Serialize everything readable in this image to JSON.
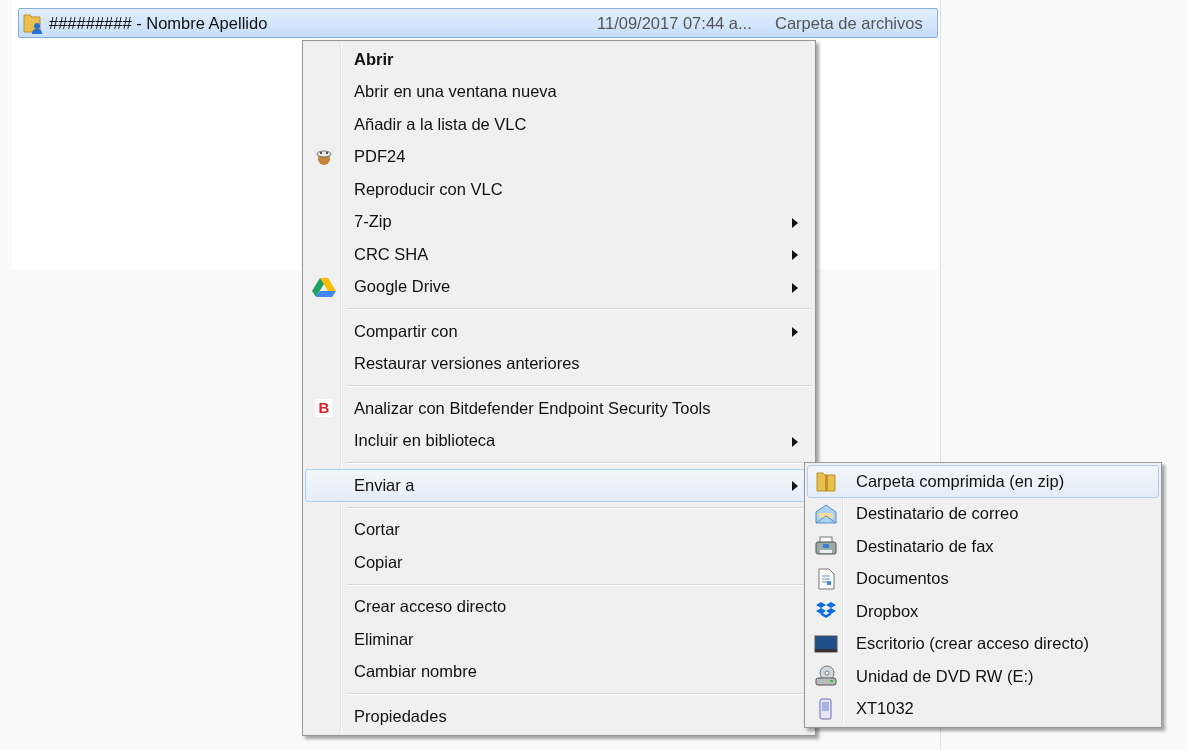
{
  "file_row": {
    "name": "######### - Nombre Apellido",
    "date_modified": "11/09/2017 07:44 a...",
    "type": "Carpeta de archivos",
    "selected": true
  },
  "context_menu": {
    "items": [
      {
        "kind": "item",
        "label": "Abrir",
        "bold": true,
        "submenu": false,
        "selected": false
      },
      {
        "kind": "item",
        "label": "Abrir en una ventana nueva",
        "bold": false,
        "submenu": false,
        "selected": false
      },
      {
        "kind": "item",
        "label": "Añadir a la lista de VLC",
        "bold": false,
        "submenu": false,
        "selected": false
      },
      {
        "kind": "item",
        "label": "PDF24",
        "bold": false,
        "submenu": false,
        "selected": false
      },
      {
        "kind": "item",
        "label": "Reproducir con VLC",
        "bold": false,
        "submenu": false,
        "selected": false
      },
      {
        "kind": "item",
        "label": "7-Zip",
        "bold": false,
        "submenu": true,
        "selected": false
      },
      {
        "kind": "item",
        "label": "CRC SHA",
        "bold": false,
        "submenu": true,
        "selected": false
      },
      {
        "kind": "item",
        "label": "Google Drive",
        "bold": false,
        "submenu": true,
        "selected": false
      },
      {
        "kind": "separator"
      },
      {
        "kind": "item",
        "label": "Compartir con",
        "bold": false,
        "submenu": true,
        "selected": false
      },
      {
        "kind": "item",
        "label": "Restaurar versiones anteriores",
        "bold": false,
        "submenu": false,
        "selected": false
      },
      {
        "kind": "separator"
      },
      {
        "kind": "item",
        "label": "Analizar con Bitdefender Endpoint Security Tools",
        "bold": false,
        "submenu": false,
        "selected": false,
        "badge": "B"
      },
      {
        "kind": "item",
        "label": "Incluir en biblioteca",
        "bold": false,
        "submenu": true,
        "selected": false
      },
      {
        "kind": "separator"
      },
      {
        "kind": "item",
        "label": "Enviar a",
        "bold": false,
        "submenu": true,
        "selected": true
      },
      {
        "kind": "separator"
      },
      {
        "kind": "item",
        "label": "Cortar",
        "bold": false,
        "submenu": false,
        "selected": false
      },
      {
        "kind": "item",
        "label": "Copiar",
        "bold": false,
        "submenu": false,
        "selected": false
      },
      {
        "kind": "separator"
      },
      {
        "kind": "item",
        "label": "Crear acceso directo",
        "bold": false,
        "submenu": false,
        "selected": false
      },
      {
        "kind": "item",
        "label": "Eliminar",
        "bold": false,
        "submenu": false,
        "selected": false
      },
      {
        "kind": "item",
        "label": "Cambiar nombre",
        "bold": false,
        "submenu": false,
        "selected": false
      },
      {
        "kind": "separator"
      },
      {
        "kind": "item",
        "label": "Propiedades",
        "bold": false,
        "submenu": false,
        "selected": false
      }
    ]
  },
  "send_to_menu": {
    "items": [
      {
        "label": "Carpeta comprimida (en zip)",
        "selected": true
      },
      {
        "label": "Destinatario de correo",
        "selected": false
      },
      {
        "label": "Destinatario de fax",
        "selected": false
      },
      {
        "label": "Documentos",
        "selected": false
      },
      {
        "label": "Dropbox",
        "selected": false
      },
      {
        "label": "Escritorio (crear acceso directo)",
        "selected": false
      },
      {
        "label": "Unidad de DVD RW (E:)",
        "selected": false
      },
      {
        "label": "XT1032",
        "selected": false
      }
    ]
  }
}
